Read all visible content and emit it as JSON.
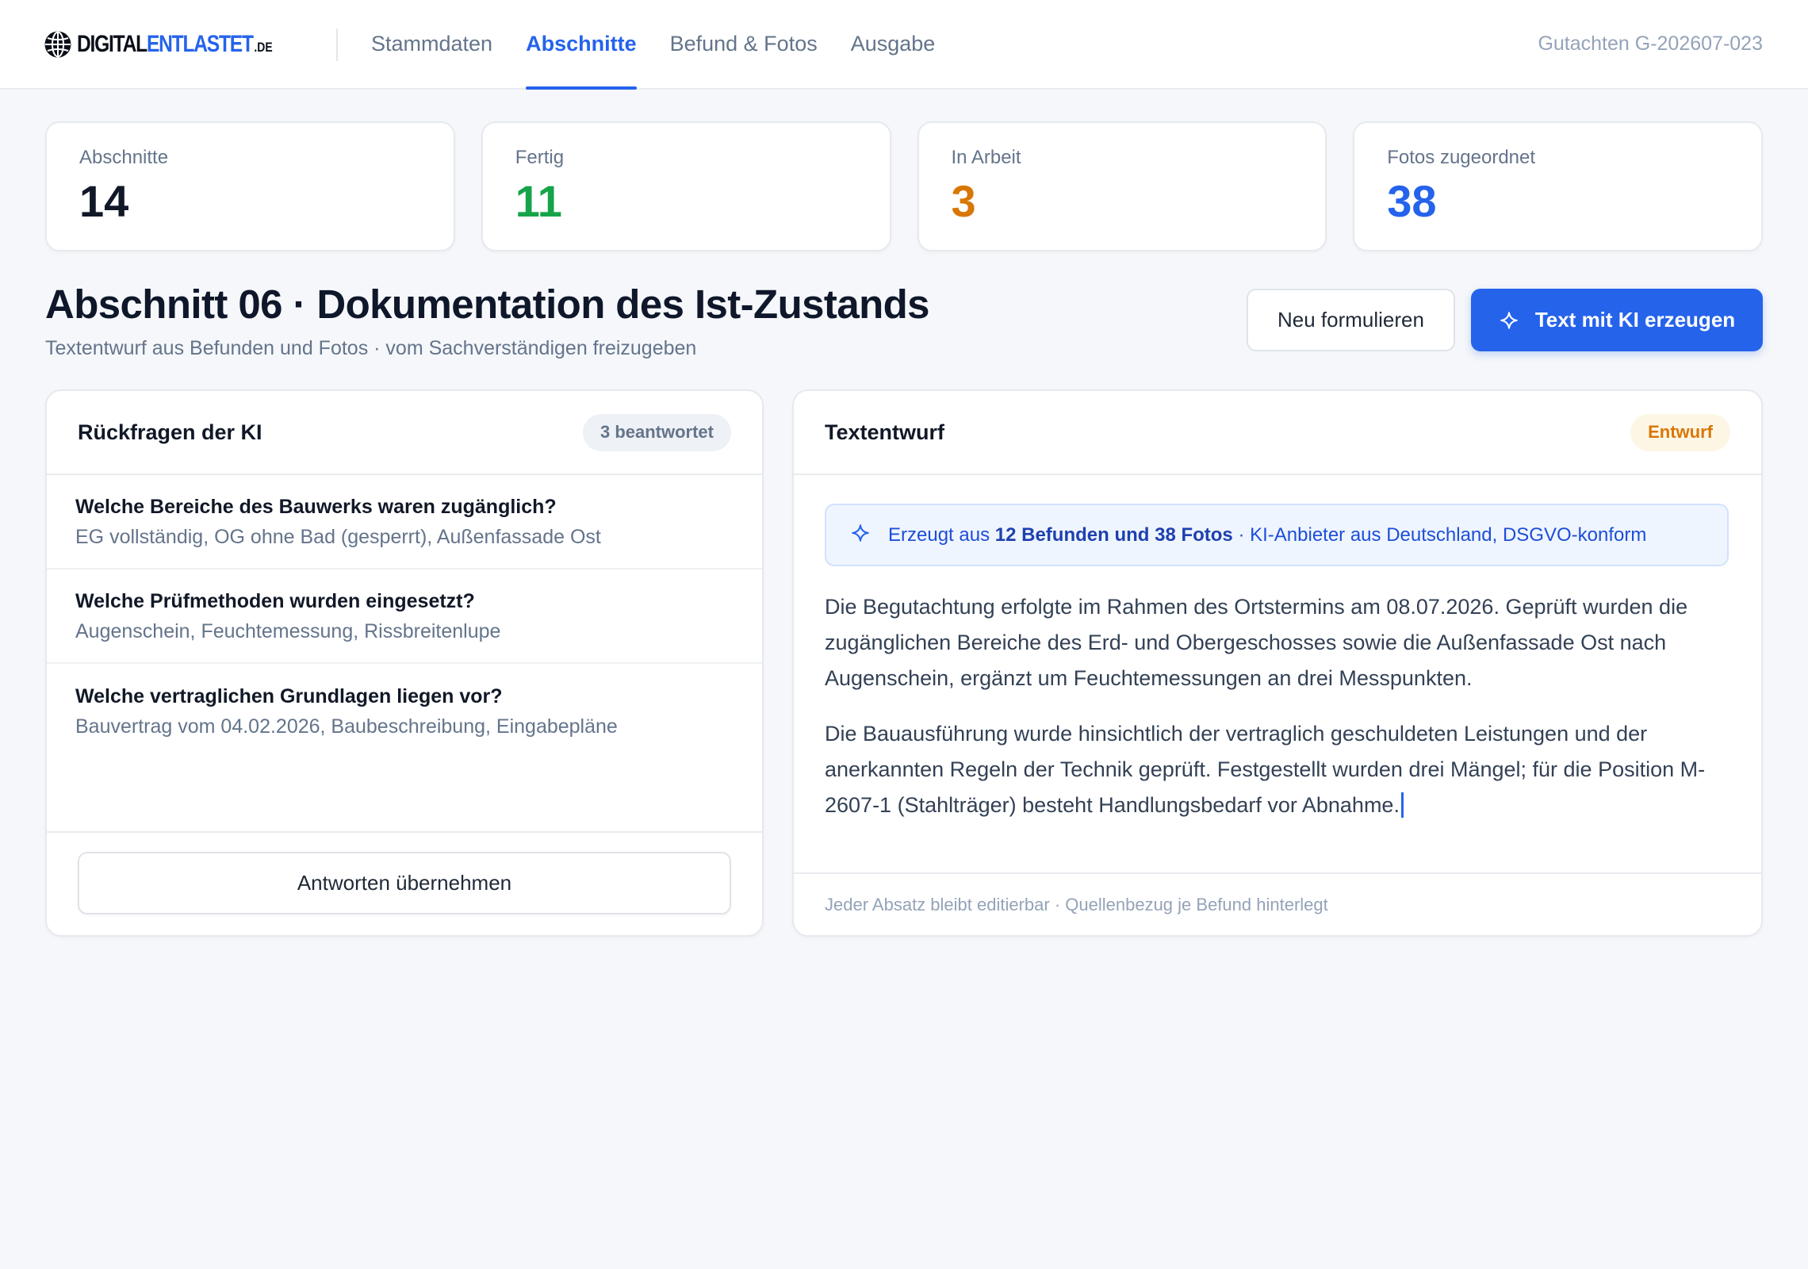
{
  "header": {
    "logo": {
      "part1": "DIGITAL",
      "part2": "ENTLASTET",
      "part3": ".DE",
      "icon": "globe-icon"
    },
    "nav": [
      {
        "label": "Stammdaten",
        "active": false
      },
      {
        "label": "Abschnitte",
        "active": true
      },
      {
        "label": "Befund & Fotos",
        "active": false
      },
      {
        "label": "Ausgabe",
        "active": false
      }
    ],
    "document_id": "Gutachten G-202607-023"
  },
  "stats": [
    {
      "label": "Abschnitte",
      "value": "14",
      "color": "#111827"
    },
    {
      "label": "Fertig",
      "value": "11",
      "color": "#16a34a"
    },
    {
      "label": "In Arbeit",
      "value": "3",
      "color": "#d97706"
    },
    {
      "label": "Fotos zugeordnet",
      "value": "38",
      "color": "#2563eb"
    }
  ],
  "section": {
    "title": "Abschnitt 06 · Dokumentation des Ist-Zustands",
    "subtitle": "Textentwurf aus Befunden und Fotos · vom Sachverständigen freizugeben",
    "rephrase_label": "Neu formulieren",
    "generate_label": "Text mit KI erzeugen",
    "generate_icon": "sparkle-icon"
  },
  "questions_panel": {
    "title": "Rückfragen der KI",
    "badge": "3 beantwortet",
    "items": [
      {
        "question": "Welche Bereiche des Bauwerks waren zugänglich?",
        "answer": "EG vollständig, OG ohne Bad (gesperrt), Außenfassade Ost"
      },
      {
        "question": "Welche Prüfmethoden wurden eingesetzt?",
        "answer": "Augenschein, Feuchtemessung, Rissbreitenlupe"
      },
      {
        "question": "Welche vertraglichen Grundlagen liegen vor?",
        "answer": "Bauvertrag vom 04.02.2026, Baubeschreibung, Eingabepläne"
      }
    ],
    "apply_label": "Antworten übernehmen"
  },
  "draft_panel": {
    "title": "Textentwurf",
    "status": "Entwurf",
    "info": {
      "icon": "sparkle-icon",
      "prefix": "Erzeugt aus ",
      "highlight": "12 Befunden und 38 Fotos",
      "suffix": " · KI-Anbieter aus Deutschland, DSGVO-konform"
    },
    "paragraphs": [
      "Die Begutachtung erfolgte im Rahmen des Ortstermins am 08.07.2026. Geprüft wurden die zugänglichen Bereiche des Erd- und Obergeschosses sowie die Außenfassade Ost nach Augenschein, ergänzt um Feuchtemessungen an drei Messpunkten.",
      "Die Bauausführung wurde hinsichtlich der vertraglich geschuldeten Leistungen und der anerkannten Regeln der Technik geprüft. Festgestellt wurden drei Mängel; für die Position M-2607-1 (Stahlträger) besteht Handlungsbedarf vor Abnahme."
    ],
    "footer": "Jeder Absatz bleibt editierbar · Quellenbezug je Befund hinterlegt"
  },
  "colors": {
    "accent": "#2563eb",
    "success": "#16a34a",
    "warning": "#d97706",
    "text": "#111827",
    "muted": "#64748b",
    "background": "#f5f7fa"
  }
}
